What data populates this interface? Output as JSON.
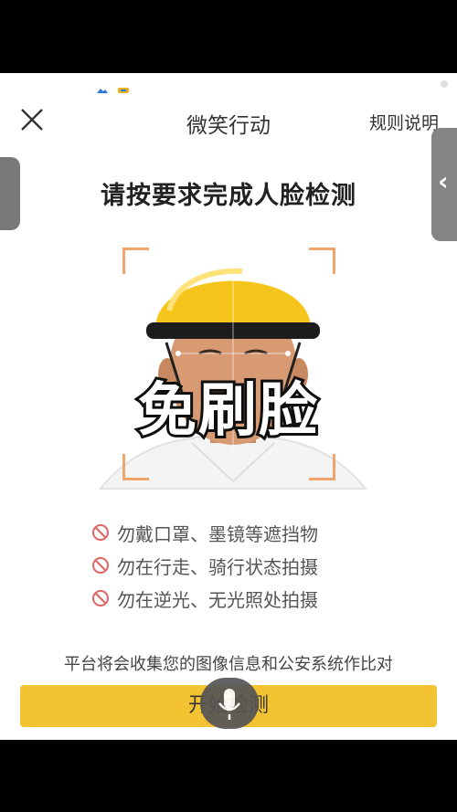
{
  "nav": {
    "title": "微笑行动",
    "rules_label": "规则说明"
  },
  "heading": "请按要求完成人脸检测",
  "overlay_text": "免刷脸",
  "rules": [
    {
      "text": "勿戴口罩、墨镜等遮挡物"
    },
    {
      "text": "勿在行走、骑行状态拍摄"
    },
    {
      "text": "勿在逆光、无光照处拍摄"
    }
  ],
  "notice": "平台将会收集您的图像信息和公安系统作比对",
  "start_button": "开始检测",
  "colors": {
    "accent": "#f4c331",
    "corner": "#f2a56b",
    "ban": "#e06666"
  },
  "icons": [
    "close-icon",
    "chevron-left-icon",
    "ban-icon",
    "microphone-icon"
  ]
}
